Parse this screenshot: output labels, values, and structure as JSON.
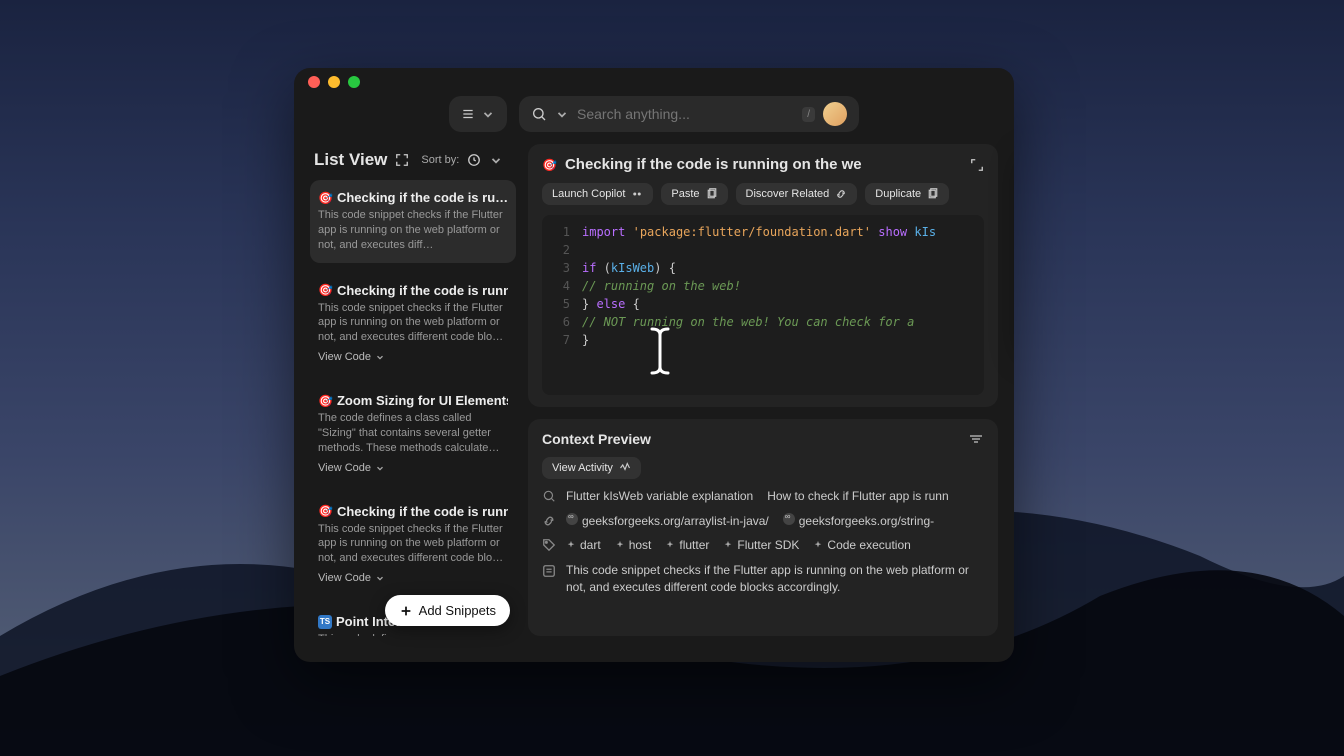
{
  "topbar": {
    "search_placeholder": "Search anything...",
    "kbd_hint": "/"
  },
  "list": {
    "title": "List View",
    "sort_label": "Sort by:",
    "add_button": "Add Snippets",
    "view_code_label": "View Code",
    "items": [
      {
        "icon": "🎯",
        "title": "Checking if the code is ru…",
        "desc": "This code snippet checks if the Flutter app is running on the web platform or not, and executes diff…",
        "selected": true,
        "show_view_code": false
      },
      {
        "icon": "🎯",
        "title": "Checking if the code is runni…",
        "desc": "This code snippet checks if the Flutter app is running on the web platform or not, and executes different code blo…",
        "selected": false,
        "show_view_code": true
      },
      {
        "icon": "🎯",
        "title": "Zoom Sizing for UI Elements",
        "desc": "The code defines a class called \"Sizing\" that contains several getter methods. These methods calculate a…",
        "selected": false,
        "show_view_code": true
      },
      {
        "icon": "🎯",
        "title": "Checking if the code is runni…",
        "desc": "This code snippet checks if the Flutter app is running on the web platform or not, and executes different code blo…",
        "selected": false,
        "show_view_code": true
      },
      {
        "icon": "ts",
        "title": "Point Inte…",
        "desc": "This code defin…",
        "selected": false,
        "show_view_code": false
      }
    ]
  },
  "detail": {
    "icon": "🎯",
    "title": "Checking if the code is running on the we",
    "actions": {
      "copilot": "Launch Copilot",
      "paste": "Paste",
      "discover": "Discover Related",
      "duplicate": "Duplicate"
    },
    "code_lines": [
      {
        "n": "1",
        "parts": [
          [
            "kw",
            "import"
          ],
          [
            "plain",
            " "
          ],
          [
            "str",
            "'package:flutter/foundation.dart'"
          ],
          [
            "plain",
            " "
          ],
          [
            "kw",
            "show"
          ],
          [
            "plain",
            " "
          ],
          [
            "ident",
            "kIs"
          ]
        ]
      },
      {
        "n": "2",
        "parts": []
      },
      {
        "n": "3",
        "parts": [
          [
            "kw",
            "if"
          ],
          [
            "plain",
            " ("
          ],
          [
            "ident",
            "kIsWeb"
          ],
          [
            "plain",
            ") {"
          ]
        ]
      },
      {
        "n": "4",
        "parts": [
          [
            "plain",
            "  "
          ],
          [
            "cmt",
            "// running on the web!"
          ]
        ]
      },
      {
        "n": "5",
        "parts": [
          [
            "plain",
            "} "
          ],
          [
            "kw",
            "else"
          ],
          [
            "plain",
            " {"
          ]
        ]
      },
      {
        "n": "6",
        "parts": [
          [
            "plain",
            "  "
          ],
          [
            "cmt",
            "// NOT running on the web! You can check for a"
          ]
        ]
      },
      {
        "n": "7",
        "parts": [
          [
            "plain",
            "}"
          ]
        ]
      }
    ]
  },
  "context": {
    "title": "Context Preview",
    "view_activity": "View Activity",
    "search_items": [
      "Flutter kIsWeb variable explanation",
      "How to check if Flutter app is runn"
    ],
    "links": [
      "geeksforgeeks.org/arraylist-in-java/",
      "geeksforgeeks.org/string-"
    ],
    "tags": [
      "dart",
      "host",
      "flutter",
      "Flutter SDK",
      "Code execution"
    ],
    "desc": "This code snippet checks if the Flutter app is running on the web platform or not, and executes different code blocks accordingly."
  }
}
